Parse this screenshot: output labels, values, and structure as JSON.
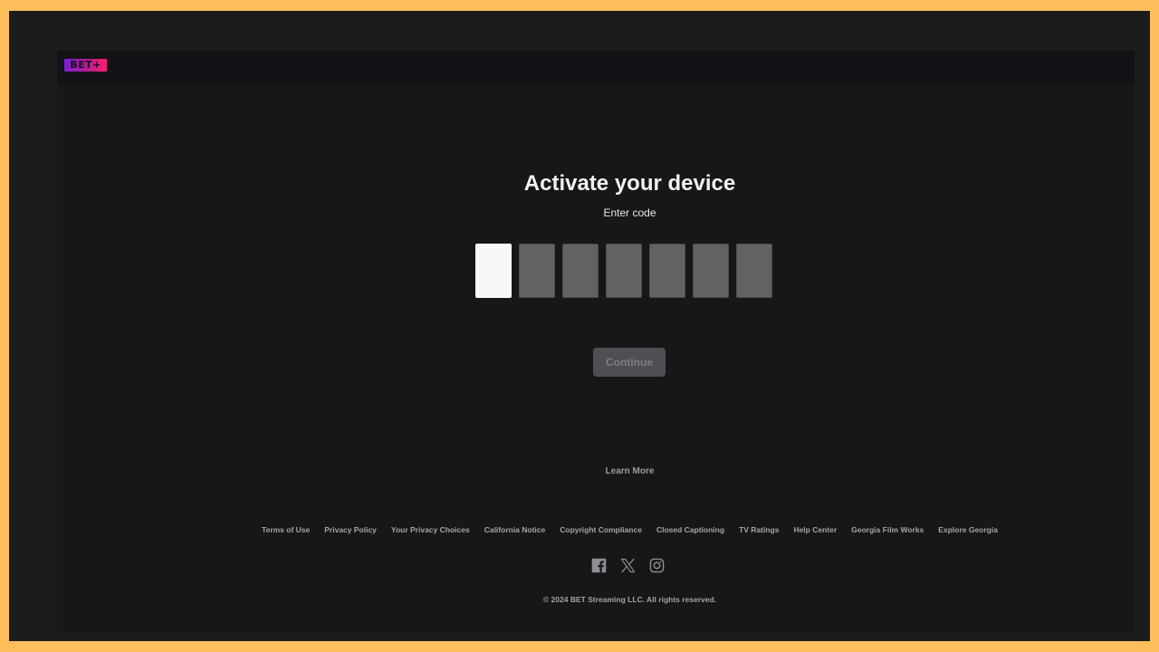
{
  "header": {
    "logo_text": "BET+",
    "logo_colors": [
      "#7a1fd6",
      "#c01c8d",
      "#ff1e6e"
    ]
  },
  "main": {
    "title": "Activate your device",
    "subtitle": "Enter code",
    "code_boxes": [
      "",
      "",
      "",
      "",
      "",
      "",
      ""
    ],
    "continue_label": "Continue"
  },
  "learn_more": "Learn More",
  "footer": {
    "links": [
      "Terms of Use",
      "Privacy Policy",
      "Your Privacy Choices",
      "California Notice",
      "Copyright Compliance",
      "Closed Captioning",
      "TV Ratings",
      "Help Center",
      "Georgia Film Works",
      "Explore Georgia"
    ],
    "social_icons": [
      "facebook-icon",
      "x-icon",
      "instagram-icon"
    ],
    "copyright": "© 2024 BET Streaming LLC. All rights reserved."
  }
}
